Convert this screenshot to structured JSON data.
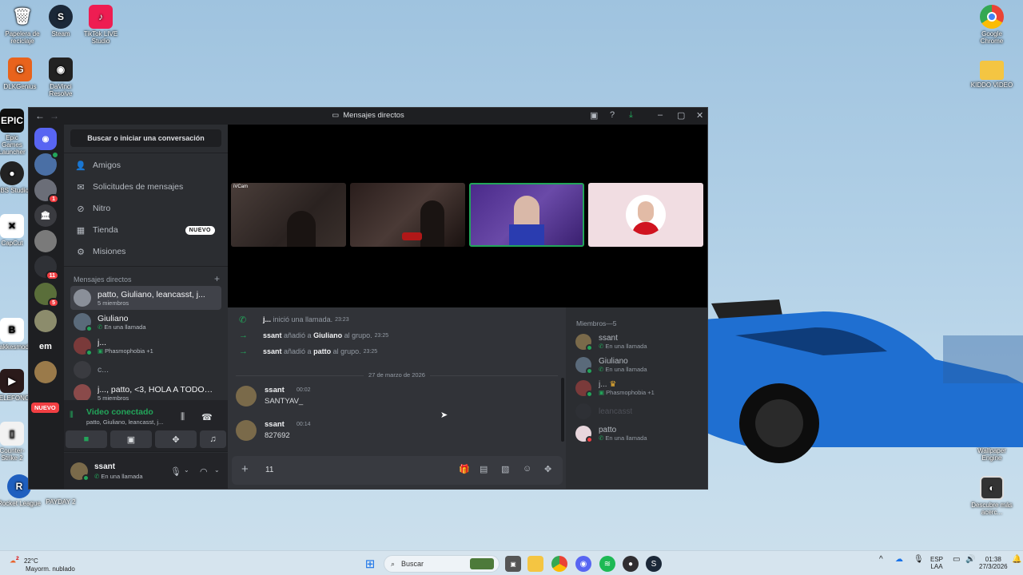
{
  "desktop": {
    "icons_left": [
      {
        "label": "Papelera de reciclaje",
        "icon": "recycle-bin-icon"
      },
      {
        "label": "Steam",
        "icon": "steam-icon"
      },
      {
        "label": "TikTok LIVE Studio",
        "icon": "tiktok-icon"
      },
      {
        "label": "DLKGenius",
        "icon": "app-icon"
      },
      {
        "label": "DaVinci Resolve",
        "icon": "davinci-icon"
      },
      {
        "label": "Epic Games Launcher",
        "icon": "epic-icon"
      },
      {
        "label": "OBS Studio",
        "icon": "obs-icon"
      },
      {
        "label": "CapCut",
        "icon": "capcut-icon"
      },
      {
        "label": "Bakkesmod",
        "icon": "bakkesmod-icon"
      },
      {
        "label": "TELEFONO",
        "icon": "phone-icon"
      },
      {
        "label": "Counter-Strike 2",
        "icon": "cs2-icon"
      },
      {
        "label": "Rocket League",
        "icon": "rocket-league-icon"
      },
      {
        "label": "PAYDAY 2",
        "icon": "payday-icon"
      }
    ],
    "icons_right": [
      {
        "label": "Google Chrome",
        "icon": "chrome-icon"
      },
      {
        "label": "KIDDO VIDEO",
        "icon": "folder-icon"
      },
      {
        "label": "Wallpaper Engine",
        "icon": "wallpaper-engine-icon"
      },
      {
        "label": "Descubre más acerc...",
        "icon": "discover-icon"
      }
    ]
  },
  "window": {
    "title": "Mensajes directos",
    "search_label": "Buscar o iniciar una conversación",
    "nav": [
      {
        "label": "Amigos",
        "icon": "friends-icon"
      },
      {
        "label": "Solicitudes de mensajes",
        "icon": "mail-icon"
      },
      {
        "label": "Nitro",
        "icon": "nitro-icon"
      },
      {
        "label": "Tienda",
        "icon": "shop-icon",
        "badge": "NUEVO"
      },
      {
        "label": "Misiones",
        "icon": "quests-icon"
      }
    ],
    "dm_header": "Mensajes directos",
    "dms": [
      {
        "name": "patto, Giuliano, leancasst, j...",
        "sub": "5 miembros",
        "selected": true
      },
      {
        "name": "Giuliano",
        "sub": "En una llamada"
      },
      {
        "name": "j...",
        "sub": "Phasmophobia +1"
      },
      {
        "name": "c...",
        "sub": ""
      },
      {
        "name": "j..., patto, <3, HOLA A TODOS Y...",
        "sub": "5 miembros"
      }
    ],
    "rail": {
      "badges": [
        "1",
        "11",
        "5"
      ],
      "text_server": "em",
      "new_label": "NUEVO"
    },
    "voice": {
      "title": "Video conectado",
      "sub": "patto, Giuliano, leancasst, j..."
    },
    "user": {
      "name": "ssant",
      "status": "En una llamada"
    },
    "stage": {
      "tile_label": "iVCam"
    },
    "chat": {
      "system": [
        {
          "actor": "j...",
          "text": "inició una llamada.",
          "time": "23:23"
        },
        {
          "actor": "ssant",
          "text": "añadió a",
          "target": "Giuliano",
          "tail": "al grupo.",
          "time": "23:25"
        },
        {
          "actor": "ssant",
          "text": "añadió a",
          "target": "patto",
          "tail": "al grupo.",
          "time": "23:25"
        }
      ],
      "date_divider": "27 de marzo de 2026",
      "messages": [
        {
          "author": "ssant",
          "time": "00:02",
          "body": "SANTYAV_"
        },
        {
          "author": "ssant",
          "time": "00:14",
          "body": "827692"
        }
      ],
      "input_value": "11"
    },
    "members": {
      "header": "Miembros—5",
      "list": [
        {
          "name": "ssant",
          "status": "En una llamada",
          "offline": false
        },
        {
          "name": "Giuliano",
          "status": "En una llamada",
          "offline": false
        },
        {
          "name": "j...",
          "status": "Phasmophobia +1",
          "offline": false
        },
        {
          "name": "leancasst",
          "status": "",
          "offline": true
        },
        {
          "name": "patto",
          "status": "En una llamada",
          "offline": false
        }
      ]
    }
  },
  "taskbar": {
    "weather_temp": "22°C",
    "weather_desc": "Mayorm. nublado",
    "weather_badge": "2",
    "search_label": "Buscar",
    "lang_top": "ESP",
    "lang_bottom": "LAA",
    "time": "01:38",
    "date": "27/3/2026"
  }
}
